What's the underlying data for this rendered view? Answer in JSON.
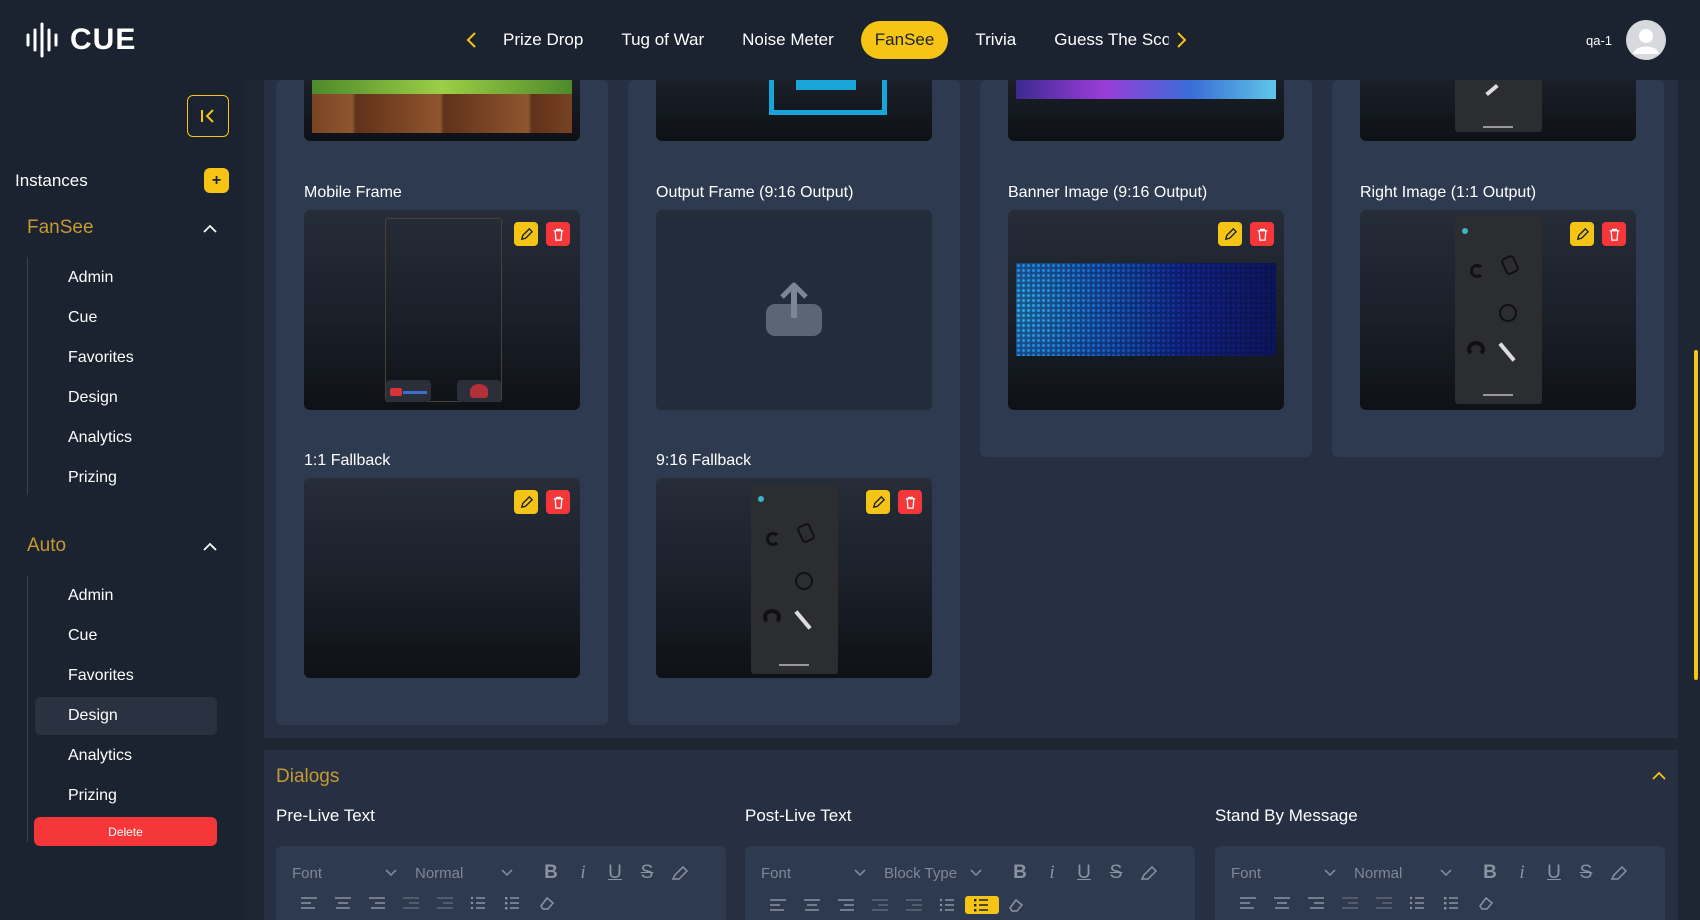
{
  "brand": {
    "logo_text": "CUE",
    "accent": "#f5c414",
    "danger": "#f6373a"
  },
  "nav": {
    "prev_icon": "chevron-left-icon",
    "next_icon": "chevron-right-icon",
    "tabs": [
      "Prize Drop",
      "Tug of War",
      "Noise Meter",
      "FanSee",
      "Trivia",
      "Guess The Sco"
    ],
    "active_tab": "FanSee"
  },
  "user": {
    "name": "qa-1"
  },
  "sidebar": {
    "instances_label": "Instances",
    "add_label": "+",
    "groups": [
      {
        "title": "FanSee",
        "items": [
          "Admin",
          "Cue",
          "Favorites",
          "Design",
          "Analytics",
          "Prizing"
        ]
      },
      {
        "title": "Auto",
        "items": [
          "Admin",
          "Cue",
          "Favorites",
          "Design",
          "Analytics",
          "Prizing"
        ],
        "selected": "Design"
      }
    ],
    "delete_label": "Delete"
  },
  "assets": {
    "col1": [
      {
        "label": "Mobile Frame"
      },
      {
        "label": "1:1 Fallback"
      }
    ],
    "col2": [
      {
        "label": "Output Frame (9:16 Output)"
      },
      {
        "label": "9:16 Fallback"
      }
    ],
    "col3": [
      {
        "label": "Banner Image (9:16 Output)"
      }
    ],
    "col4": [
      {
        "label": "Right Image (1:1 Output)"
      }
    ]
  },
  "dialogs": {
    "title": "Dialogs",
    "editors": [
      {
        "label": "Pre-Live Text",
        "font": "Font",
        "format": "Normal"
      },
      {
        "label": "Post-Live Text",
        "font": "Font",
        "format": "Block Type"
      },
      {
        "label": "Stand By Message",
        "font": "Font",
        "format": "Normal"
      }
    ]
  }
}
